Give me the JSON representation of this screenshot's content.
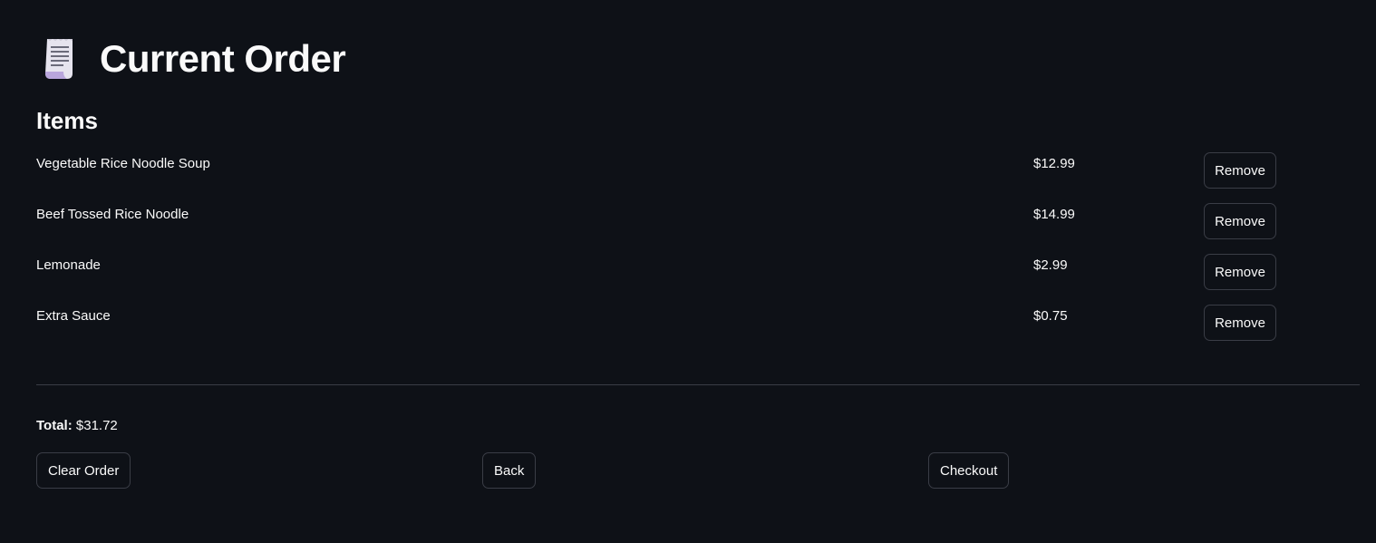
{
  "header": {
    "icon": "receipt-icon",
    "title": "Current Order"
  },
  "items_section": {
    "title": "Items",
    "remove_label": "Remove",
    "items": [
      {
        "name": "Vegetable Rice Noodle Soup",
        "price": "$12.99"
      },
      {
        "name": "Beef Tossed Rice Noodle",
        "price": "$14.99"
      },
      {
        "name": "Lemonade",
        "price": "$2.99"
      },
      {
        "name": "Extra Sauce",
        "price": "$0.75"
      }
    ]
  },
  "summary": {
    "total_label": "Total:",
    "total_value": "$31.72"
  },
  "actions": {
    "clear_label": "Clear Order",
    "back_label": "Back",
    "checkout_label": "Checkout"
  },
  "colors": {
    "background": "#0e1117",
    "text": "#fafafa",
    "border": "#3a3d46"
  }
}
